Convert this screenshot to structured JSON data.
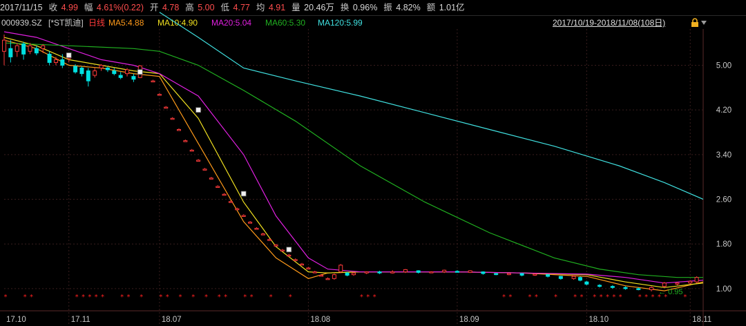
{
  "quote": {
    "date": "2017/11/15",
    "close_label": "收",
    "close_value": "4.99",
    "change_label": "幅",
    "change_value": "4.61%(0.22)",
    "open_label": "开",
    "open_value": "4.78",
    "high_label": "高",
    "high_value": "5.00",
    "low_label": "低",
    "low_value": "4.77",
    "avg_label": "均",
    "avg_value": "4.91",
    "volume_label": "量",
    "volume_value": "20.46万",
    "turnover_label": "换",
    "turnover_value": "0.96%",
    "amplitude_label": "振",
    "amplitude_value": "4.82%",
    "amount_label": "额",
    "amount_value": "1.01亿"
  },
  "legend": {
    "code": "000939.SZ",
    "name": "[*ST凯迪]",
    "period": "日线",
    "ma5": "MA5:4.88",
    "ma10": "MA10:4.90",
    "ma20": "MA20:5.04",
    "ma60": "MA60:5.30",
    "ma120": "MA120:5.99",
    "range": "2017/10/19-2018/11/08(108日)"
  },
  "colors": {
    "up": "#ff3b3b",
    "down": "#00e0e0",
    "ma5": "#ff9a1a",
    "ma10": "#f0e020",
    "ma20": "#e020e0",
    "ma60": "#20b020",
    "ma120": "#40e0e0",
    "grid": "#3a1e1e",
    "axis": "#c8c8c8",
    "star": "#ff2020"
  },
  "chart_data": {
    "type": "line",
    "title": "",
    "x_range": [
      0,
      108
    ],
    "ylim": [
      0.85,
      5.6
    ],
    "y_ticks": [
      1.0,
      1.8,
      2.6,
      3.4,
      4.2,
      5.0
    ],
    "y_tick_labels": [
      "1.00",
      "1.80",
      "2.60",
      "3.40",
      "4.20",
      "5.00"
    ],
    "x_ticks": [
      {
        "x": 0,
        "label": "17.10"
      },
      {
        "x": 10,
        "label": "17.11"
      },
      {
        "x": 24,
        "label": "18.07"
      },
      {
        "x": 47,
        "label": "18.08"
      },
      {
        "x": 70,
        "label": "18.09"
      },
      {
        "x": 90,
        "label": "18.10"
      },
      {
        "x": 106,
        "label": "18.11"
      }
    ],
    "vertical_grid_x": [
      10,
      24,
      47,
      70,
      90,
      106
    ],
    "low_marker": {
      "x": 100,
      "y": 0.95,
      "label": "0.95"
    },
    "series": [
      {
        "name": "MA5",
        "color_key": "ma5",
        "x": [
          0,
          5,
          10,
          15,
          20,
          24,
          30,
          37,
          42,
          47,
          50,
          55,
          60,
          70,
          80,
          90,
          96,
          102,
          108
        ],
        "y": [
          5.45,
          5.3,
          5.0,
          4.95,
          4.85,
          4.8,
          3.6,
          2.2,
          1.55,
          1.18,
          1.28,
          1.3,
          1.3,
          1.3,
          1.28,
          1.22,
          1.05,
          0.96,
          1.12
        ]
      },
      {
        "name": "MA10",
        "color_key": "ma10",
        "x": [
          0,
          5,
          10,
          15,
          20,
          24,
          30,
          37,
          42,
          47,
          50,
          55,
          60,
          70,
          80,
          90,
          96,
          102,
          108
        ],
        "y": [
          5.5,
          5.35,
          5.1,
          5.0,
          4.9,
          4.85,
          4.05,
          2.55,
          1.75,
          1.3,
          1.28,
          1.3,
          1.3,
          1.3,
          1.28,
          1.25,
          1.12,
          1.02,
          1.1
        ]
      },
      {
        "name": "MA20",
        "color_key": "ma20",
        "x": [
          0,
          5,
          10,
          15,
          20,
          24,
          30,
          37,
          42,
          47,
          50,
          55,
          60,
          70,
          80,
          90,
          96,
          102,
          108
        ],
        "y": [
          5.6,
          5.5,
          5.3,
          5.1,
          5.0,
          4.85,
          4.45,
          3.4,
          2.3,
          1.55,
          1.35,
          1.3,
          1.3,
          1.3,
          1.28,
          1.26,
          1.2,
          1.1,
          1.15
        ]
      },
      {
        "name": "MA60",
        "color_key": "ma60",
        "x": [
          0,
          10,
          20,
          24,
          30,
          37,
          45,
          55,
          65,
          75,
          85,
          92,
          98,
          104,
          108
        ],
        "y": [
          5.4,
          5.35,
          5.3,
          5.25,
          5.0,
          4.55,
          4.0,
          3.2,
          2.55,
          2.0,
          1.55,
          1.35,
          1.25,
          1.2,
          1.2
        ]
      },
      {
        "name": "MA120",
        "color_key": "ma120",
        "x": [
          24,
          30,
          37,
          45,
          55,
          65,
          75,
          85,
          95,
          102,
          108
        ],
        "y": [
          5.95,
          5.5,
          4.95,
          4.72,
          4.45,
          4.15,
          3.85,
          3.55,
          3.2,
          2.9,
          2.6
        ]
      }
    ],
    "candles": [
      {
        "x": 0,
        "o": 5.25,
        "c": 5.45,
        "h": 5.55,
        "l": 5.0
      },
      {
        "x": 1,
        "o": 5.3,
        "c": 5.15,
        "h": 5.45,
        "l": 5.05
      },
      {
        "x": 2,
        "o": 5.25,
        "c": 5.35,
        "h": 5.4,
        "l": 5.15
      },
      {
        "x": 3,
        "o": 5.38,
        "c": 5.2,
        "h": 5.42,
        "l": 5.1
      },
      {
        "x": 4,
        "o": 5.25,
        "c": 5.35,
        "h": 5.4,
        "l": 5.2
      },
      {
        "x": 5,
        "o": 5.3,
        "c": 5.22,
        "h": 5.35,
        "l": 5.18
      },
      {
        "x": 6,
        "o": 5.3,
        "c": 5.35,
        "h": 5.38,
        "l": 5.22
      },
      {
        "x": 7,
        "o": 5.2,
        "c": 5.05,
        "h": 5.25,
        "l": 5.0
      },
      {
        "x": 8,
        "o": 5.05,
        "c": 5.1,
        "h": 5.15,
        "l": 5.0
      },
      {
        "x": 9,
        "o": 5.1,
        "c": 5.0,
        "h": 5.2,
        "l": 4.95
      },
      {
        "x": 10,
        "o": 5.12,
        "c": 5.18,
        "h": 5.22,
        "l": 5.05
      },
      {
        "x": 11,
        "o": 4.98,
        "c": 4.88,
        "h": 5.02,
        "l": 4.85
      },
      {
        "x": 12,
        "o": 4.95,
        "c": 4.85,
        "h": 4.98,
        "l": 4.8
      },
      {
        "x": 13,
        "o": 4.9,
        "c": 4.72,
        "h": 4.95,
        "l": 4.62
      },
      {
        "x": 14,
        "o": 4.82,
        "c": 4.9,
        "h": 4.95,
        "l": 4.78
      },
      {
        "x": 15,
        "o": 4.95,
        "c": 5.0,
        "h": 5.02,
        "l": 4.9
      },
      {
        "x": 16,
        "o": 4.95,
        "c": 4.92,
        "h": 4.98,
        "l": 4.88
      },
      {
        "x": 17,
        "o": 4.9,
        "c": 4.85,
        "h": 4.95,
        "l": 4.82
      },
      {
        "x": 18,
        "o": 4.82,
        "c": 4.78,
        "h": 4.88,
        "l": 4.75
      },
      {
        "x": 19,
        "o": 4.85,
        "c": 4.92,
        "h": 4.95,
        "l": 4.8
      },
      {
        "x": 20,
        "o": 4.8,
        "c": 4.75,
        "h": 4.85,
        "l": 4.7
      },
      {
        "x": 21,
        "o": 4.78,
        "c": 4.99,
        "h": 5.0,
        "l": 4.77
      },
      {
        "x": 23,
        "o": 4.72,
        "c": 4.72,
        "h": 4.74,
        "l": 4.7
      },
      {
        "x": 24,
        "o": 4.48,
        "c": 4.48,
        "h": 4.5,
        "l": 4.46
      },
      {
        "x": 25,
        "o": 4.25,
        "c": 4.25,
        "h": 4.27,
        "l": 4.23
      },
      {
        "x": 26,
        "o": 4.05,
        "c": 4.05,
        "h": 4.07,
        "l": 4.03
      },
      {
        "x": 27,
        "o": 3.85,
        "c": 3.85,
        "h": 3.87,
        "l": 3.83
      },
      {
        "x": 28,
        "o": 3.65,
        "c": 3.65,
        "h": 3.67,
        "l": 3.63
      },
      {
        "x": 29,
        "o": 3.48,
        "c": 3.48,
        "h": 3.5,
        "l": 3.46
      },
      {
        "x": 30,
        "o": 3.3,
        "c": 3.3,
        "h": 3.32,
        "l": 3.28
      },
      {
        "x": 31,
        "o": 3.14,
        "c": 3.14,
        "h": 3.16,
        "l": 3.12
      },
      {
        "x": 32,
        "o": 2.98,
        "c": 2.98,
        "h": 3.0,
        "l": 2.96
      },
      {
        "x": 33,
        "o": 2.83,
        "c": 2.83,
        "h": 2.85,
        "l": 2.81
      },
      {
        "x": 34,
        "o": 2.69,
        "c": 2.69,
        "h": 2.71,
        "l": 2.67
      },
      {
        "x": 35,
        "o": 2.56,
        "c": 2.56,
        "h": 2.58,
        "l": 2.54
      },
      {
        "x": 36,
        "o": 2.43,
        "c": 2.43,
        "h": 2.45,
        "l": 2.41
      },
      {
        "x": 37,
        "o": 2.31,
        "c": 2.31,
        "h": 2.33,
        "l": 2.29
      },
      {
        "x": 38,
        "o": 2.19,
        "c": 2.19,
        "h": 2.21,
        "l": 2.17
      },
      {
        "x": 39,
        "o": 2.08,
        "c": 2.08,
        "h": 2.1,
        "l": 2.06
      },
      {
        "x": 40,
        "o": 1.98,
        "c": 1.98,
        "h": 2.0,
        "l": 1.96
      },
      {
        "x": 41,
        "o": 1.88,
        "c": 1.88,
        "h": 1.9,
        "l": 1.86
      },
      {
        "x": 42,
        "o": 1.78,
        "c": 1.78,
        "h": 1.8,
        "l": 1.76
      },
      {
        "x": 43,
        "o": 1.69,
        "c": 1.69,
        "h": 1.71,
        "l": 1.67
      },
      {
        "x": 44,
        "o": 1.6,
        "c": 1.6,
        "h": 1.62,
        "l": 1.58
      },
      {
        "x": 45,
        "o": 1.52,
        "c": 1.52,
        "h": 1.54,
        "l": 1.5
      },
      {
        "x": 46,
        "o": 1.44,
        "c": 1.44,
        "h": 1.46,
        "l": 1.42
      },
      {
        "x": 47,
        "o": 1.37,
        "c": 1.37,
        "h": 1.39,
        "l": 1.35
      },
      {
        "x": 48,
        "o": 1.3,
        "c": 1.3,
        "h": 1.32,
        "l": 1.28
      },
      {
        "x": 49,
        "o": 1.24,
        "c": 1.24,
        "h": 1.26,
        "l": 1.22
      },
      {
        "x": 50,
        "o": 1.18,
        "c": 1.18,
        "h": 1.2,
        "l": 1.16
      },
      {
        "x": 51,
        "o": 1.18,
        "c": 1.25,
        "h": 1.27,
        "l": 1.16
      },
      {
        "x": 52,
        "o": 1.3,
        "c": 1.42,
        "h": 1.44,
        "l": 1.28
      },
      {
        "x": 53,
        "o": 1.28,
        "c": 1.24,
        "h": 1.3,
        "l": 1.22
      },
      {
        "x": 54,
        "o": 1.25,
        "c": 1.28,
        "h": 1.3,
        "l": 1.23
      },
      {
        "x": 56,
        "o": 1.28,
        "c": 1.3,
        "h": 1.31,
        "l": 1.26
      },
      {
        "x": 58,
        "o": 1.3,
        "c": 1.28,
        "h": 1.32,
        "l": 1.26
      },
      {
        "x": 60,
        "o": 1.28,
        "c": 1.3,
        "h": 1.33,
        "l": 1.27
      },
      {
        "x": 62,
        "o": 1.3,
        "c": 1.34,
        "h": 1.35,
        "l": 1.28
      },
      {
        "x": 64,
        "o": 1.32,
        "c": 1.29,
        "h": 1.33,
        "l": 1.27
      },
      {
        "x": 66,
        "o": 1.3,
        "c": 1.3,
        "h": 1.31,
        "l": 1.29
      },
      {
        "x": 68,
        "o": 1.3,
        "c": 1.33,
        "h": 1.34,
        "l": 1.28
      },
      {
        "x": 70,
        "o": 1.31,
        "c": 1.3,
        "h": 1.33,
        "l": 1.29
      },
      {
        "x": 72,
        "o": 1.29,
        "c": 1.32,
        "h": 1.33,
        "l": 1.28
      },
      {
        "x": 74,
        "o": 1.3,
        "c": 1.27,
        "h": 1.31,
        "l": 1.25
      },
      {
        "x": 76,
        "o": 1.27,
        "c": 1.25,
        "h": 1.28,
        "l": 1.24
      },
      {
        "x": 78,
        "o": 1.25,
        "c": 1.27,
        "h": 1.28,
        "l": 1.24
      },
      {
        "x": 80,
        "o": 1.27,
        "c": 1.24,
        "h": 1.28,
        "l": 1.22
      },
      {
        "x": 82,
        "o": 1.24,
        "c": 1.26,
        "h": 1.27,
        "l": 1.23
      },
      {
        "x": 84,
        "o": 1.25,
        "c": 1.22,
        "h": 1.26,
        "l": 1.2
      },
      {
        "x": 86,
        "o": 1.22,
        "c": 1.18,
        "h": 1.23,
        "l": 1.16
      },
      {
        "x": 88,
        "o": 1.18,
        "c": 1.22,
        "h": 1.24,
        "l": 1.16
      },
      {
        "x": 89,
        "o": 1.2,
        "c": 1.15,
        "h": 1.22,
        "l": 1.13
      },
      {
        "x": 90,
        "o": 1.12,
        "c": 1.08,
        "h": 1.14,
        "l": 1.06
      },
      {
        "x": 92,
        "o": 1.06,
        "c": 1.04,
        "h": 1.08,
        "l": 1.02
      },
      {
        "x": 94,
        "o": 1.04,
        "c": 1.02,
        "h": 1.06,
        "l": 1.0
      },
      {
        "x": 96,
        "o": 1.02,
        "c": 1.0,
        "h": 1.04,
        "l": 0.98
      },
      {
        "x": 98,
        "o": 1.0,
        "c": 0.99,
        "h": 1.02,
        "l": 0.97
      },
      {
        "x": 100,
        "o": 0.98,
        "c": 1.02,
        "h": 1.04,
        "l": 0.95
      },
      {
        "x": 102,
        "o": 1.04,
        "c": 1.1,
        "h": 1.12,
        "l": 1.02
      },
      {
        "x": 104,
        "o": 1.08,
        "c": 1.1,
        "h": 1.12,
        "l": 1.06
      },
      {
        "x": 106,
        "o": 1.1,
        "c": 1.13,
        "h": 1.15,
        "l": 1.08
      },
      {
        "x": 107,
        "o": 1.12,
        "c": 1.2,
        "h": 1.22,
        "l": 1.1
      }
    ],
    "markers": [
      {
        "x": 10,
        "y": 5.18
      },
      {
        "x": 21,
        "y": 4.88
      },
      {
        "x": 30,
        "y": 4.2
      },
      {
        "x": 37,
        "y": 2.7
      },
      {
        "x": 44,
        "y": 1.7
      }
    ],
    "stars": [
      0,
      3,
      4,
      11,
      12,
      13,
      14,
      15,
      18,
      19,
      21,
      24,
      25,
      27,
      29,
      31,
      33,
      34,
      37,
      38,
      41,
      44,
      55,
      56,
      57,
      77,
      78,
      81,
      82,
      85,
      88,
      89,
      91,
      92,
      93,
      94,
      95,
      98,
      99,
      100,
      101,
      102,
      105
    ]
  }
}
